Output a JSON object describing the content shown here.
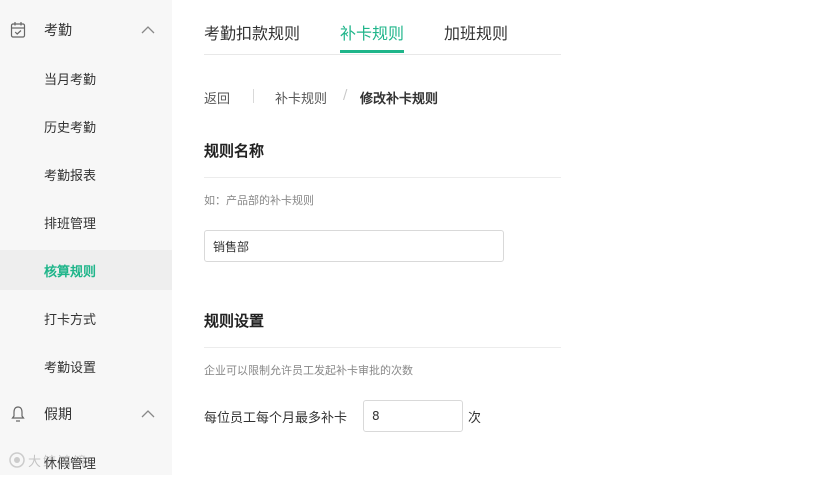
{
  "sidebar": {
    "groups": [
      {
        "label": "考勤",
        "icon": "calendar-icon",
        "expanded": true
      },
      {
        "label": "假期",
        "icon": "bell-icon",
        "expanded": true
      }
    ],
    "items": [
      {
        "label": "当月考勤",
        "active": false
      },
      {
        "label": "历史考勤",
        "active": false
      },
      {
        "label": "考勤报表",
        "active": false
      },
      {
        "label": "排班管理",
        "active": false
      },
      {
        "label": "核算规则",
        "active": true
      },
      {
        "label": "打卡方式",
        "active": false
      },
      {
        "label": "考勤设置",
        "active": false
      }
    ],
    "partial_item": "休假管理"
  },
  "tabs": [
    {
      "label": "考勤扣款规则",
      "active": false
    },
    {
      "label": "补卡规则",
      "active": true
    },
    {
      "label": "加班规则",
      "active": false
    }
  ],
  "breadcrumb": {
    "back": "返回",
    "parent": "补卡规则",
    "separator": "/",
    "current": "修改补卡规则"
  },
  "rule_name": {
    "title": "规则名称",
    "hint": "如：产品部的补卡规则",
    "value": "销售部"
  },
  "rule_settings": {
    "title": "规则设置",
    "hint": "企业可以限制允许员工发起补卡审批的次数",
    "limit_label": "每位员工每个月最多补卡",
    "limit_value": "8",
    "unit": "次"
  },
  "watermark": {
    "text": "大鲸鸿镜"
  },
  "colors": {
    "accent": "#1fb58a",
    "sidebar_bg": "#f7f7f7",
    "active_item_bg": "#eeeeee"
  }
}
